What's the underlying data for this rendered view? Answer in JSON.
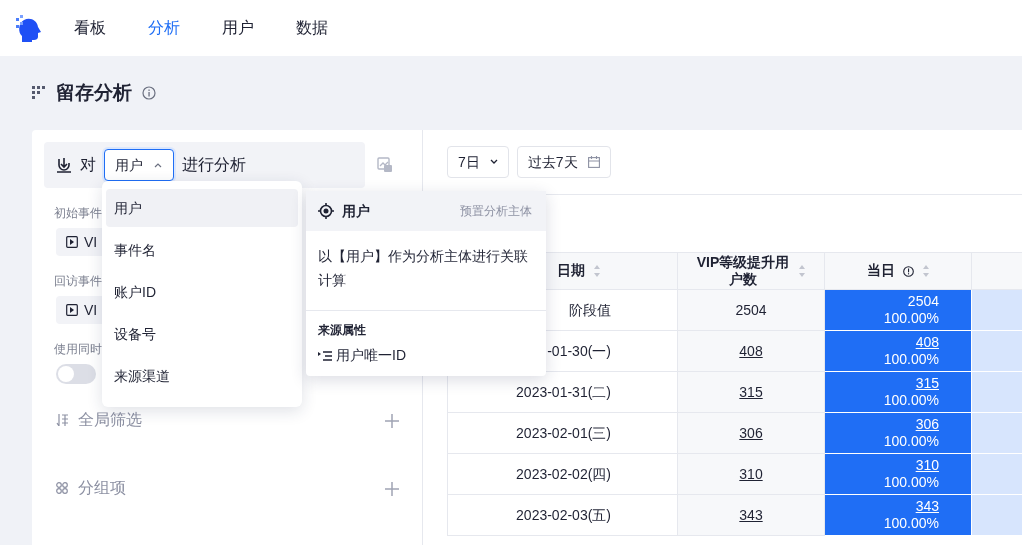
{
  "nav": {
    "items": [
      {
        "label": "看板",
        "selected": false
      },
      {
        "label": "分析",
        "selected": true
      },
      {
        "label": "用户",
        "selected": false
      },
      {
        "label": "数据",
        "selected": false
      }
    ]
  },
  "page": {
    "title": "留存分析"
  },
  "subject_bar": {
    "prefix": "对",
    "value": "用户",
    "suffix": "进行分析",
    "expanded": true
  },
  "config": [
    {
      "kind": "event",
      "label": "初始事件",
      "event": "VI"
    },
    {
      "kind": "event",
      "label": "回访事件",
      "event": "VI"
    },
    {
      "kind": "switch",
      "label": "使用同时",
      "on": false
    }
  ],
  "sections": [
    {
      "kind": "filter",
      "label": "全局筛选"
    },
    {
      "kind": "group",
      "label": "分组项"
    }
  ],
  "subject_menu": {
    "items": [
      {
        "label": "用户",
        "selected": true
      },
      {
        "label": "事件名",
        "selected": false
      },
      {
        "label": "账户ID",
        "selected": false
      },
      {
        "label": "设备号",
        "selected": false
      },
      {
        "label": "来源渠道",
        "selected": false
      }
    ]
  },
  "subject_detail": {
    "title": "用户",
    "tag": "预置分析主体",
    "description": "以【用户】作为分析主体进行关联计算",
    "source_heading": "来源属性",
    "source_field": "用户唯一ID"
  },
  "toolbar": {
    "granularity": "7日",
    "date_range": "过去7天"
  },
  "table": {
    "columns": [
      {
        "label": "日期",
        "info": false
      },
      {
        "label": "VIP等级提升用户数",
        "info": false
      },
      {
        "label": "当日",
        "info": true
      }
    ],
    "rows": [
      {
        "date": "阶段值",
        "count": "2504",
        "day0": "2504",
        "day0_rate": "100.00%",
        "linked": false
      },
      {
        "date": "-01-30(一)",
        "count": "408",
        "day0": "408",
        "day0_rate": "100.00%",
        "linked": true
      },
      {
        "date": "2023-01-31(二)",
        "count": "315",
        "day0": "315",
        "day0_rate": "100.00%",
        "linked": true
      },
      {
        "date": "2023-02-01(三)",
        "count": "306",
        "day0": "306",
        "day0_rate": "100.00%",
        "linked": true
      },
      {
        "date": "2023-02-02(四)",
        "count": "310",
        "day0": "310",
        "day0_rate": "100.00%",
        "linked": true
      },
      {
        "date": "2023-02-03(五)",
        "count": "343",
        "day0": "343",
        "day0_rate": "100.00%",
        "linked": true
      }
    ]
  }
}
